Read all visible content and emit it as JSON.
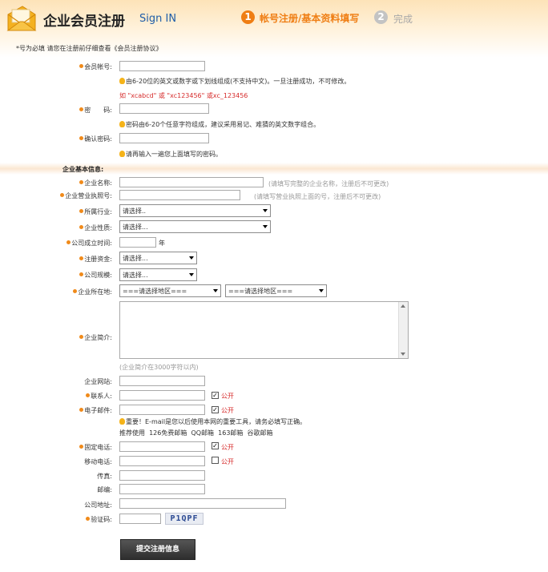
{
  "header": {
    "title": "企业会员注册",
    "subtitle": "Sign IN",
    "step1_num": "1",
    "step1_label": "帐号注册/基本资料填写",
    "step2_num": "2",
    "step2_label": "完成"
  },
  "note": "*号为必填 请您在注册前仔细查看《会员注册协议》",
  "account": {
    "username_label": "会员帐号:",
    "username_value": "",
    "username_hint": "由6-20位的英文或数字或下划线组成(不支持中文)。一旦注册成功，不可修改。",
    "username_example": "如 \"xcabcd\" 或 \"xc123456\" 或xc_123456",
    "password_label": "密　　码:",
    "password_value": "",
    "password_hint": "密码由6-20个任意字符组成，建议采用易记、难猜的英文数字组合。",
    "confirm_label": "确认密码:",
    "confirm_value": "",
    "confirm_hint": "请再输入一遍您上面填写的密码。"
  },
  "company": {
    "section_label": "企业基本信息:",
    "name_label": "企业名称:",
    "name_value": "",
    "name_hint": "(请填写完整的企业名称，注册后不可更改)",
    "license_label": "企业营业执照号:",
    "license_value": "",
    "license_hint": "(请填写营业执照上面的号，注册后不可更改)",
    "industry_label": "所属行业:",
    "industry_selected": "请选择..",
    "nature_label": "企业性质:",
    "nature_selected": "请选择...",
    "founded_label": "公司成立时间:",
    "founded_value": "",
    "founded_unit": "年",
    "capital_label": "注册资金:",
    "capital_selected": "请选择...",
    "scale_label": "公司规模:",
    "scale_selected": "请选择...",
    "location_label": "企业所在地:",
    "province_selected": "===请选择地区===",
    "city_selected": "===请选择地区===",
    "intro_label": "企业简介:",
    "intro_value": "",
    "intro_hint": "(企业简介在3000字符以内)"
  },
  "contact": {
    "website_label": "企业网站:",
    "website_value": "",
    "person_label": "联系人:",
    "person_value": "",
    "person_public": true,
    "email_label": "电子邮件:",
    "email_value": "",
    "email_public": true,
    "email_hint": "重要！E-mail是您以后使用本网的重要工具，请务必填写正确。",
    "email_recommend": "推荐使用",
    "email_links": [
      "126免费邮箱",
      "QQ邮箱",
      "163邮箱",
      "谷歌邮箱"
    ],
    "phone_label": "固定电话:",
    "phone_value": "",
    "phone_public": true,
    "mobile_label": "移动电话:",
    "mobile_value": "",
    "mobile_public": false,
    "fax_label": "传真:",
    "fax_value": "",
    "zip_label": "邮编:",
    "zip_value": "",
    "address_label": "公司地址:",
    "address_value": "",
    "captcha_label": "验证码:",
    "captcha_value": "",
    "captcha_image_text": "P1QPF",
    "public_label": "公开"
  },
  "submit_label": "提交注册信息",
  "colors": {
    "accent": "#ef7e14",
    "public_red": "#d62b2b",
    "header_bg": "#fde3b8"
  }
}
